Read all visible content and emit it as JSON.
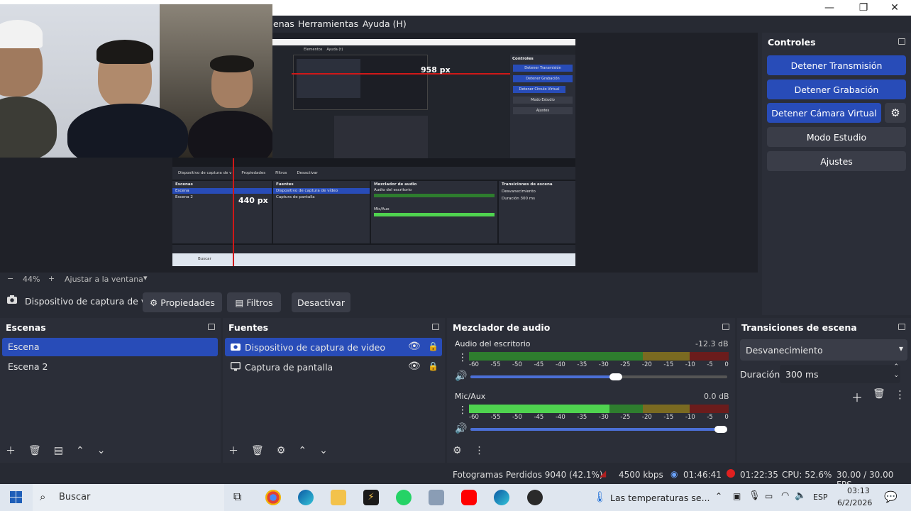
{
  "menu": {
    "escenas": "enas",
    "herramientas": "Herramientas",
    "ayuda": "Ayuda (H)"
  },
  "preview": {
    "nested_measure_1": "958 px",
    "nested_measure_2": "440 px",
    "nested_menu": [
      "Elementos",
      "Ayuda (t)"
    ],
    "nested_controls_title": "Controles",
    "nested_controls": [
      "Detener Transmisión",
      "Detener Grabación",
      "Detener Círculo Virtual",
      "Modo Estudio",
      "Ajustes"
    ],
    "nested_toolbar": [
      "Dispositivo de captura de v",
      "Propiedades",
      "Filtros",
      "Desactivar"
    ],
    "nested_docks": [
      "Escenas",
      "Fuentes",
      "Mezclador de audio",
      "Transiciones de escena"
    ],
    "nested_scenes": [
      "Escena",
      "Escena 2"
    ],
    "nested_sources": [
      "Dispositivo de captura de vídeo",
      "Captura de pantalla"
    ],
    "nested_mixer": [
      "Audio del escritorio",
      "Mic/Aux"
    ],
    "nested_transition": "Desvanecimiento",
    "nested_duration_label": "Duración",
    "nested_duration": "300 ms",
    "nested_search": "Buscar"
  },
  "zoom": {
    "minus": "−",
    "value": "44%",
    "plus": "+",
    "fit_label": "Ajustar a la ventana"
  },
  "source_toolbar": {
    "source_name": "Dispositivo de captura de v",
    "properties": "Propiedades",
    "filters": "Filtros",
    "deactivate": "Desactivar"
  },
  "controls": {
    "title": "Controles",
    "stop_stream": "Detener Transmisión",
    "stop_recording": "Detener Grabación",
    "stop_virtualcam": "Detener Cámara Virtual",
    "studio_mode": "Modo Estudio",
    "settings": "Ajustes"
  },
  "scenes": {
    "title": "Escenas",
    "items": [
      "Escena",
      "Escena 2"
    ]
  },
  "sources": {
    "title": "Fuentes",
    "items": [
      "Dispositivo de captura de video",
      "Captura de pantalla"
    ]
  },
  "mixer": {
    "title": "Mezclador de audio",
    "ticks": [
      "-60",
      "-55",
      "-50",
      "-45",
      "-40",
      "-35",
      "-30",
      "-25",
      "-20",
      "-15",
      "-10",
      "-5",
      "0"
    ],
    "channels": [
      {
        "name": "Audio del escritorio",
        "db": "-12.3 dB",
        "level": 0.0,
        "volume": 0.59
      },
      {
        "name": "Mic/Aux",
        "db": "0.0 dB",
        "level": 0.54,
        "volume": 1.0
      }
    ]
  },
  "transitions": {
    "title": "Transiciones de escena",
    "type": "Desvanecimiento",
    "duration_label": "Duración",
    "duration": "300 ms"
  },
  "status": {
    "dropped": "Fotogramas Perdidos 9040 (42.1%)",
    "bitrate": "4500 kbps",
    "stream_time": "01:46:41",
    "rec_time": "01:22:35",
    "cpu": "CPU: 52.6%",
    "fps": "30.00 / 30.00 FPS"
  },
  "taskbar": {
    "search": "Buscar",
    "weather": "Las temperaturas se...",
    "lang": "ESP",
    "time": "03:13",
    "date": "6/2/2026"
  },
  "colors": {
    "accent": "#284cb8",
    "panel": "#2b2e38",
    "bg": "#272a33",
    "record": "#e02020"
  }
}
